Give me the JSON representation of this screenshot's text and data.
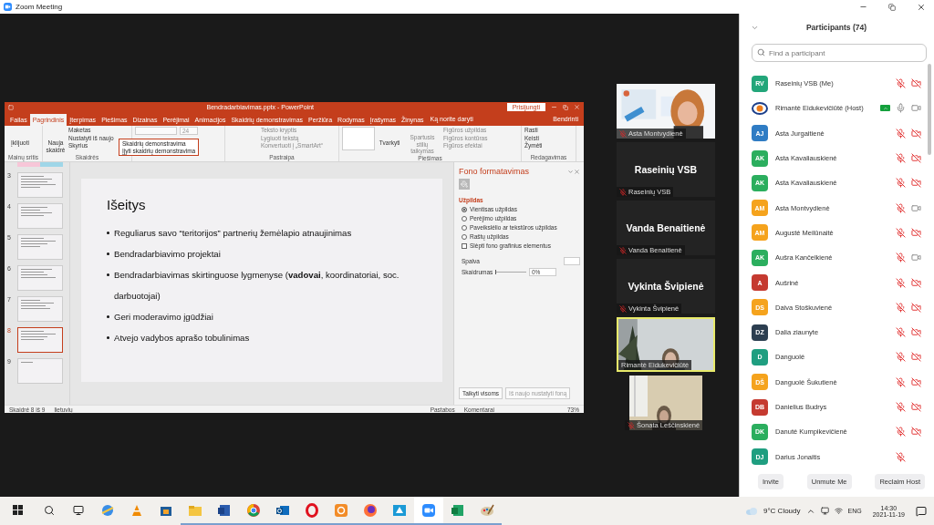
{
  "window": {
    "title": "Zoom Meeting"
  },
  "powerpoint": {
    "title": "Bendradarbiavimas.pptx - PowerPoint",
    "sign_in": "Prisijungti",
    "share": "Bendrinti",
    "tell_me": "Ką norite daryti",
    "tabs": [
      {
        "label": "Failas",
        "selected": false
      },
      {
        "label": "Pagrindinis",
        "selected": true
      },
      {
        "label": "Įterpimas",
        "selected": false
      },
      {
        "label": "Piešimas",
        "selected": false
      },
      {
        "label": "Dizainas",
        "selected": false
      },
      {
        "label": "Perėjimai",
        "selected": false
      },
      {
        "label": "Animacijos",
        "selected": false
      },
      {
        "label": "Skaidrių demonstravimas",
        "selected": false
      },
      {
        "label": "Peržiūra",
        "selected": false
      },
      {
        "label": "Rodymas",
        "selected": false
      },
      {
        "label": "Įrašymas",
        "selected": false
      },
      {
        "label": "Žinynas",
        "selected": false
      }
    ],
    "ribbon": {
      "clipboard": {
        "paste": "Įklijuoti",
        "label": "Mainų sritis"
      },
      "slides": {
        "new_slide": "Nauja skaidrė",
        "items": [
          "Maketas",
          "Nustatyti iš naujo",
          "Skyrius"
        ],
        "label": "Skaidrės"
      },
      "font": {
        "size": "24"
      },
      "tooltip": {
        "title": "Skaidrių demonstravima",
        "text": "Įjyti skaidrių demonstravima"
      },
      "paragraph": {
        "items": [
          "Teksto kryptis",
          "Lygiuoti tekstą",
          "Konvertuoti į „SmartArt“"
        ],
        "label": "Pastraipa"
      },
      "drawing": {
        "arrange": "Tvarkyti",
        "quick_styles": "Spartusis stilių taikymas",
        "items": [
          "Figūros užpildas",
          "Figūros kontūras",
          "Figūros efektai"
        ],
        "label": "Piešimas"
      },
      "editing": {
        "items": [
          "Rasti",
          "Keisti",
          "Žymėti"
        ],
        "label": "Redagavimas"
      }
    },
    "thumbnails": [
      {
        "number": "3",
        "selected": false
      },
      {
        "number": "4",
        "selected": false
      },
      {
        "number": "5",
        "selected": false
      },
      {
        "number": "6",
        "selected": false
      },
      {
        "number": "7",
        "selected": false
      },
      {
        "number": "8",
        "selected": true
      },
      {
        "number": "9",
        "selected": false
      }
    ],
    "slide": {
      "title": "Išeitys",
      "bullets": [
        "Reguliarus savo “teritorijos” partnerių žemėlapio atnaujinimas",
        "Bendradarbiavimo projektai",
        "Bendradarbiavimas skirtinguose lygmenyse (**vadovai**, koordinatoriai, soc. darbuotojai)",
        "Geri moderavimo įgūdžiai",
        "Atvejo vadybos aprašo tobulinimas"
      ]
    },
    "format_pane": {
      "title": "Fono formatavimas",
      "section": "Užpildas",
      "options": [
        {
          "label": "Vientisas užpildas",
          "kind": "radio",
          "selected": true
        },
        {
          "label": "Perėjimo užpildas",
          "kind": "radio",
          "selected": false
        },
        {
          "label": "Paveikslėlio ar tekstūros užpildas",
          "kind": "radio",
          "selected": false
        },
        {
          "label": "Raštų užpildas",
          "kind": "radio",
          "selected": false
        },
        {
          "label": "Slėpti fono grafinius elementus",
          "kind": "checkbox",
          "selected": false
        }
      ],
      "color_label": "Spalva",
      "transparency_label": "Skaidrumas",
      "transparency": "0%",
      "level": 0,
      "buttons": [
        {
          "label": "Taikyti visoms",
          "disabled": false
        },
        {
          "label": "Iš naujo nustatyti foną",
          "disabled": true
        }
      ]
    },
    "status_bar": {
      "slide": "Skaidrė 8 iš 9",
      "language": "lietuvių",
      "notes": "Pastabos",
      "comments": "Komentarai",
      "zoom": "73%"
    }
  },
  "video_tiles": [
    {
      "kind": "video",
      "name": "Asta Montvydienė",
      "muted": true,
      "active": false
    },
    {
      "kind": "name",
      "display_name": "Raseinių VSB",
      "name": "Raseinių VSB",
      "muted": true,
      "active": false
    },
    {
      "kind": "name",
      "display_name": "Vanda Benaitienė",
      "name": "Vanda Benaitienė",
      "muted": true,
      "active": false
    },
    {
      "kind": "name",
      "display_name": "Vykinta Švipienė",
      "name": "Vykinta Švipienė",
      "muted": true,
      "active": false
    },
    {
      "kind": "video",
      "name": "Rimantė Eidukevičiūtė",
      "muted": false,
      "active": true
    },
    {
      "kind": "video",
      "name": "Šonata Leščinskienė",
      "muted": true,
      "active": false
    }
  ],
  "participants": {
    "title": "Participants (74)",
    "search": {
      "placeholder": "Find a participant"
    },
    "list": [
      {
        "kind": "initials",
        "initials": "RV",
        "color": "#23a67a",
        "name": "Raseinių VSB (Me)",
        "sharing": false,
        "mic_on": false,
        "camera_on": false,
        "camera_shown": true
      },
      {
        "kind": "logo",
        "name": "Rimantė Eidukevičiūtė (Host)",
        "sharing": true,
        "mic_on": true,
        "camera_on": true,
        "camera_shown": true
      },
      {
        "kind": "initials",
        "initials": "AJ",
        "color": "#2f7cc4",
        "name": "Asta Jurgaitienė",
        "sharing": false,
        "mic_on": false,
        "camera_on": false,
        "camera_shown": true
      },
      {
        "kind": "initials",
        "initials": "AK",
        "color": "#2bae5e",
        "name": "Asta Kavaliauskienė",
        "sharing": false,
        "mic_on": false,
        "camera_on": false,
        "camera_shown": true
      },
      {
        "kind": "initials",
        "initials": "AK",
        "color": "#2bae5e",
        "name": "Asta Kavaliauskienė",
        "sharing": false,
        "mic_on": false,
        "camera_on": false,
        "camera_shown": true
      },
      {
        "kind": "initials",
        "initials": "AM",
        "color": "#f5a31d",
        "name": "Asta Montvydienė",
        "sharing": false,
        "mic_on": false,
        "camera_on": true,
        "camera_shown": true
      },
      {
        "kind": "initials",
        "initials": "AM",
        "color": "#f5a31d",
        "name": "Augustė Meilūnaitė",
        "sharing": false,
        "mic_on": false,
        "camera_on": false,
        "camera_shown": true
      },
      {
        "kind": "initials",
        "initials": "AK",
        "color": "#2bae5e",
        "name": "Aušra Kančelkienė",
        "sharing": false,
        "mic_on": false,
        "camera_on": true,
        "camera_shown": true
      },
      {
        "kind": "initials",
        "initials": "A",
        "color": "#c53a30",
        "name": "Aušrinė",
        "sharing": false,
        "mic_on": false,
        "camera_on": false,
        "camera_shown": true
      },
      {
        "kind": "initials",
        "initials": "DS",
        "color": "#f5a31d",
        "name": "Daiva Stoškuvienė",
        "sharing": false,
        "mic_on": false,
        "camera_on": false,
        "camera_shown": true
      },
      {
        "kind": "initials",
        "initials": "DZ",
        "color": "#2c3e50",
        "name": "Dalia ziaunyte",
        "sharing": false,
        "mic_on": false,
        "camera_on": false,
        "camera_shown": true
      },
      {
        "kind": "initials",
        "initials": "D",
        "color": "#1f9e80",
        "name": "Danguolė",
        "sharing": false,
        "mic_on": false,
        "camera_on": false,
        "camera_shown": true
      },
      {
        "kind": "initials",
        "initials": "DŠ",
        "color": "#f5a31d",
        "name": "Danguolė Šukutienė",
        "sharing": false,
        "mic_on": false,
        "camera_on": false,
        "camera_shown": true
      },
      {
        "kind": "initials",
        "initials": "DB",
        "color": "#c53a30",
        "name": "Danielius Budrys",
        "sharing": false,
        "mic_on": false,
        "camera_on": false,
        "camera_shown": true
      },
      {
        "kind": "initials",
        "initials": "DK",
        "color": "#2bae5e",
        "name": "Danutė Kumpikevičienė",
        "sharing": false,
        "mic_on": false,
        "camera_on": false,
        "camera_shown": true
      },
      {
        "kind": "initials",
        "initials": "DJ",
        "color": "#1f9e80",
        "name": "Darius Jonaitis",
        "sharing": false,
        "mic_on": false,
        "camera_shown": false
      }
    ],
    "buttons": [
      "Invite",
      "Unmute Me",
      "Reclaim Host"
    ]
  },
  "taskbar": {
    "apps": [
      {
        "kind": "ie",
        "running": false,
        "selected": false
      },
      {
        "kind": "vlc",
        "running": false,
        "selected": false
      },
      {
        "kind": "store",
        "running": false,
        "selected": false
      },
      {
        "kind": "explorer",
        "running": true,
        "selected": false
      },
      {
        "kind": "word",
        "running": true,
        "selected": false
      },
      {
        "kind": "chrome",
        "running": true,
        "selected": false
      },
      {
        "kind": "outlook",
        "running": true,
        "selected": false
      },
      {
        "kind": "opera",
        "running": true,
        "selected": false
      },
      {
        "kind": "orange",
        "running": true,
        "selected": false
      },
      {
        "kind": "firefox",
        "running": true,
        "selected": false
      },
      {
        "kind": "teal",
        "running": true,
        "selected": false
      },
      {
        "kind": "zoom",
        "running": true,
        "selected": true
      },
      {
        "kind": "excel",
        "running": true,
        "selected": false
      },
      {
        "kind": "paint",
        "running": true,
        "selected": false
      }
    ],
    "weather": "9°C Cloudy",
    "language": "ENG",
    "time": "14:30",
    "date": "2021-11-19"
  }
}
